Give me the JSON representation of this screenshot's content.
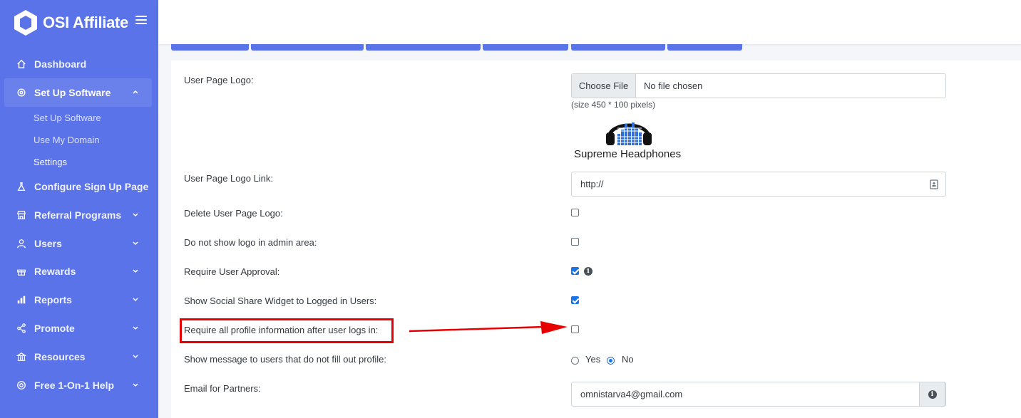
{
  "app": {
    "name": "OSI Affiliate"
  },
  "sidebar": {
    "items": [
      {
        "label": "Dashboard",
        "icon": "home-icon"
      },
      {
        "label": "Set Up Software",
        "icon": "settings-cog-icon"
      },
      {
        "label": "Configure Sign Up Page",
        "icon": "flask-icon"
      },
      {
        "label": "Referral Programs",
        "icon": "store-icon"
      },
      {
        "label": "Users",
        "icon": "user-icon"
      },
      {
        "label": "Rewards",
        "icon": "gift-icon"
      },
      {
        "label": "Reports",
        "icon": "bar-chart-icon"
      },
      {
        "label": "Promote",
        "icon": "share-icon"
      },
      {
        "label": "Resources",
        "icon": "bank-icon"
      },
      {
        "label": "Free 1-On-1 Help",
        "icon": "lifebuoy-icon"
      }
    ],
    "subitems": [
      {
        "label": "Set Up Software"
      },
      {
        "label": "Use My Domain"
      },
      {
        "label": "Settings"
      }
    ]
  },
  "form": {
    "logo_label": "User Page Logo:",
    "file_button": "Choose File",
    "file_name": "No file chosen",
    "size_hint": "(size 450 * 100 pixels)",
    "logo_image_text": "Supreme Headphones",
    "logo_link_label": "User Page Logo Link:",
    "logo_link_value": "http://",
    "delete_logo_label": "Delete User Page Logo:",
    "no_logo_admin_label": "Do not show logo in admin area:",
    "require_approval_label": "Require User Approval:",
    "social_share_label": "Show Social Share Widget to Logged in Users:",
    "require_profile_label": "Require all profile information after user logs in:",
    "show_message_label": "Show message to users that do not fill out profile:",
    "radio_yes": "Yes",
    "radio_no": "No",
    "email_label": "Email for Partners:",
    "email_value": "omnistarva4@gmail.com"
  },
  "colors": {
    "sidebar": "#5b73e8",
    "checkbox_checked": "#1a73e8",
    "highlight": "#e60000"
  }
}
